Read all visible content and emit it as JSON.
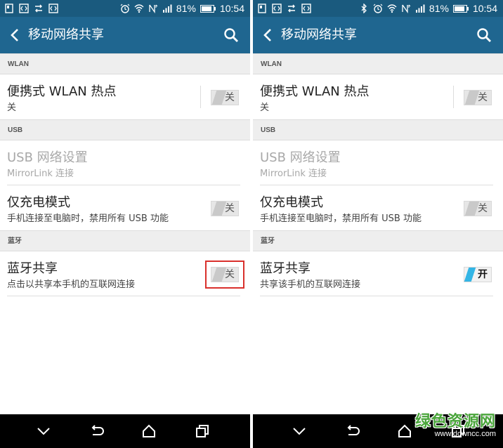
{
  "colors": {
    "status_bar": "#1a5a7e",
    "action_bar": "#1f6690",
    "section_header_bg": "#eeeeee",
    "toggle_on_accent": "#33b5e5",
    "highlight": "#d9302c",
    "nav_bar": "#000000",
    "watermark": "#4aa53b"
  },
  "left": {
    "status": {
      "icons_left": [
        "screenshot-icon",
        "code-icon",
        "data-transfer-icon",
        "code-icon"
      ],
      "icons_right": [
        "alarm-icon",
        "wifi-icon",
        "lte-icon",
        "signal-icon"
      ],
      "battery_percent": "81%",
      "time": "10:54"
    },
    "toolbar": {
      "title": "移动网络共享",
      "back_icon": "back-arrow-icon",
      "search_icon": "search-icon"
    },
    "sections": {
      "wlan": "WLAN",
      "usb": "USB",
      "bt": "蓝牙"
    },
    "items": {
      "hotspot": {
        "title": "便携式 WLAN 热点",
        "subtitle": "关",
        "toggle": "关"
      },
      "usb_net": {
        "title": "USB 网络设置",
        "subtitle": "MirrorLink 连接"
      },
      "charge": {
        "title": "仅充电模式",
        "subtitle": "手机连接至电脑时，禁用所有 USB 功能",
        "toggle": "关"
      },
      "bt_share": {
        "title": "蓝牙共享",
        "subtitle": "点击以共享本手机的互联网连接",
        "toggle": "关"
      }
    },
    "nav": [
      "chevron-down-icon",
      "back-icon",
      "home-icon",
      "recents-icon"
    ]
  },
  "right": {
    "status": {
      "icons_left": [
        "screenshot-icon",
        "code-icon",
        "data-transfer-icon",
        "code-icon"
      ],
      "icons_right": [
        "bluetooth-icon",
        "alarm-icon",
        "wifi-icon",
        "lte-icon",
        "signal-icon"
      ],
      "battery_percent": "81%",
      "time": "10:54"
    },
    "toolbar": {
      "title": "移动网络共享",
      "back_icon": "back-arrow-icon",
      "search_icon": "search-icon"
    },
    "sections": {
      "wlan": "WLAN",
      "usb": "USB",
      "bt": "蓝牙"
    },
    "items": {
      "hotspot": {
        "title": "便携式 WLAN 热点",
        "subtitle": "关",
        "toggle": "关"
      },
      "usb_net": {
        "title": "USB 网络设置",
        "subtitle": "MirrorLink 连接"
      },
      "charge": {
        "title": "仅充电模式",
        "subtitle": "手机连接至电脑时，禁用所有 USB 功能",
        "toggle": "关"
      },
      "bt_share": {
        "title": "蓝牙共享",
        "subtitle": "共享该手机的互联网连接",
        "toggle": "开"
      }
    },
    "nav": [
      "chevron-down-icon",
      "back-icon",
      "home-icon",
      "recents-icon"
    ]
  },
  "watermark": {
    "logo": "绿色资源网",
    "url": "www.downcc.com"
  }
}
